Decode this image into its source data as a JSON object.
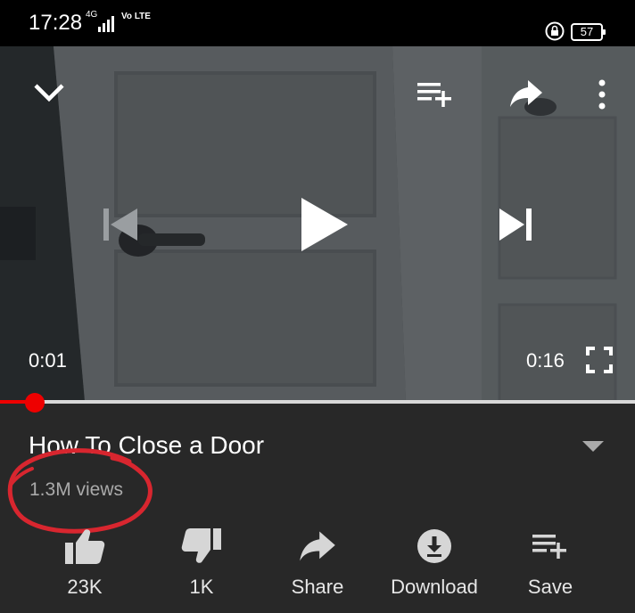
{
  "status_bar": {
    "time": "17:28",
    "network": "4G",
    "volte": "Vo LTE",
    "battery": "57"
  },
  "player": {
    "current_time": "0:01",
    "duration": "0:16",
    "progress_fraction": 0.055
  },
  "video": {
    "title": "How To Close a Door",
    "views": "1.3M views"
  },
  "actions": [
    {
      "label": "23K",
      "icon": "thumb-up-icon"
    },
    {
      "label": "1K",
      "icon": "thumb-down-icon"
    },
    {
      "label": "Share",
      "icon": "share-icon"
    },
    {
      "label": "Download",
      "icon": "download-icon"
    },
    {
      "label": "Save",
      "icon": "playlist-add-icon"
    }
  ],
  "colors": {
    "accent": "#e00000",
    "background": "#282828",
    "annotation_circle": "#d8262f"
  }
}
